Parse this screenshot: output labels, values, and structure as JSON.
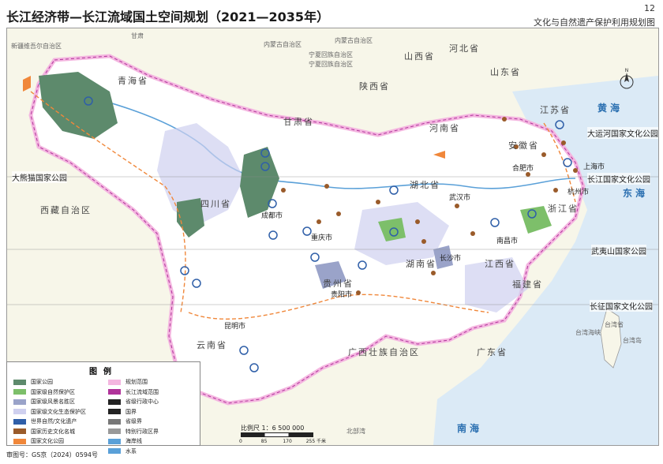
{
  "header": {
    "title": "长江经济带—长江流域国土空间规划（2021—2035年）",
    "page_number": "12",
    "subtitle": "文化与自然遗产保护利用规划图"
  },
  "map": {
    "provinces": [
      "青海省",
      "西藏自治区",
      "四川省",
      "甘肃省",
      "陕西省",
      "河南省",
      "湖北省",
      "湖南省",
      "贵州省",
      "云南省",
      "广西壮族自治区",
      "广东省",
      "福建省",
      "江西省",
      "浙江省",
      "安徽省",
      "江苏省",
      "山东省",
      "山西省",
      "河北省",
      "重庆市",
      "宁夏回族自治区",
      "内蒙古自治区",
      "新疆维吾尔自治区"
    ],
    "seas": [
      "黄海",
      "东海",
      "南海",
      "台湾海峡",
      "北部湾"
    ],
    "islands": [
      "台湾省",
      "台湾岛"
    ],
    "cities": [
      "成都市",
      "重庆市",
      "武汉市",
      "长沙市",
      "南昌市",
      "贵阳市",
      "昆明市",
      "合肥市",
      "上海市",
      "杭州市"
    ],
    "parks": [
      "大熊猫国家公园",
      "大运河国家文化公园",
      "长江国家文化公园",
      "武夷山国家公园",
      "长征国家文化公园"
    ],
    "minor_labels": [
      "甘肃",
      "内蒙古自治区",
      "宁夏回族自治区"
    ]
  },
  "legend": {
    "title": "图例",
    "left_items": [
      {
        "label": "国家公园",
        "color": "#5d8a6c"
      },
      {
        "label": "国家级自然保护区",
        "color": "#7dbf6a"
      },
      {
        "label": "国家级风景名胜区",
        "color": "#9aa3c9"
      },
      {
        "label": "国家级文化生态保护区",
        "color": "#cfd0ef"
      },
      {
        "label": "世界自然/文化遗产",
        "color": "#2f5fa8"
      },
      {
        "label": "国家历史文化名城",
        "color": "#9a5b2a"
      },
      {
        "label": "国家文化公园",
        "color": "#f0873a"
      }
    ],
    "right_items": [
      {
        "label": "规划范围",
        "color": "#f4b6e0"
      },
      {
        "label": "长江流域范围",
        "color": "#b0339a"
      },
      {
        "label": "省级行政中心",
        "color": "#222222"
      },
      {
        "label": "国界",
        "color": "#222222"
      },
      {
        "label": "省级界",
        "color": "#777777"
      },
      {
        "label": "特别行政区界",
        "color": "#999999"
      },
      {
        "label": "海岸线",
        "color": "#5aa0d8"
      },
      {
        "label": "水系",
        "color": "#5aa0d8"
      }
    ]
  },
  "scale": {
    "label": "比例尺 1：6 500 000",
    "ticks": [
      "0",
      "85",
      "170",
      "255 千米"
    ]
  },
  "approval_number": "审图号：GS京（2024）0594号",
  "colors": {
    "land": "#f7f6e9",
    "sea": "#dbeaf6",
    "region": "#ffffff",
    "planning_border": "#f4b6e0",
    "basin_border": "#b0339a",
    "national_park": "#5d8a6c",
    "scenic": "#9aa3c9",
    "culture": "#cfd0ef",
    "heritage": "#2f5fa8",
    "city_marker": "#9a5b2a",
    "culture_park": "#f0873a"
  }
}
